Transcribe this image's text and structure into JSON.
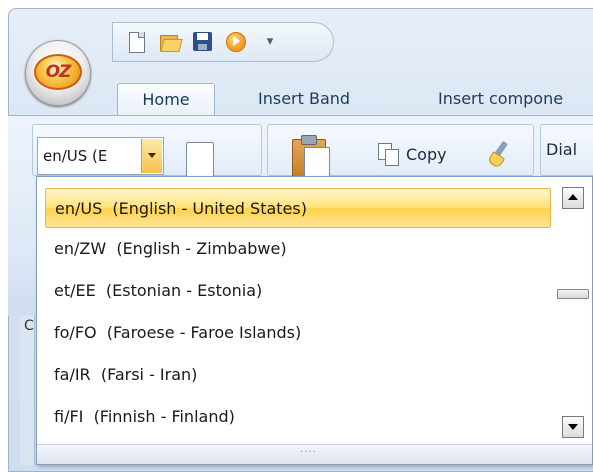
{
  "app": {
    "logo_text": "OZ"
  },
  "quick_access": {
    "buttons": [
      "new-document",
      "open-folder",
      "save",
      "run"
    ],
    "customize_glyph": "▾"
  },
  "tabs": [
    {
      "label": "Home",
      "active": true
    },
    {
      "label": "Insert Band",
      "active": false
    },
    {
      "label": "Insert compone",
      "active": false
    }
  ],
  "toolbar": {
    "locale_value": "en/US  (E",
    "copy_label": "Copy",
    "dial_label": "Dial"
  },
  "side_panel": {
    "label": "C"
  },
  "locale_dropdown": {
    "selected_index": 0,
    "items": [
      "en/US  (English - United States)",
      "en/ZW  (English - Zimbabwe)",
      "et/EE  (Estonian - Estonia)",
      "fo/FO  (Faroese - Faroe Islands)",
      "fa/IR  (Farsi - Iran)",
      "fi/FI  (Finnish - Finland)"
    ],
    "grip_text": "····"
  },
  "colors": {
    "selection_highlight": "#ffe27a",
    "ribbon_background": "#dde8f6",
    "tab_text": "#1e3a5f"
  }
}
